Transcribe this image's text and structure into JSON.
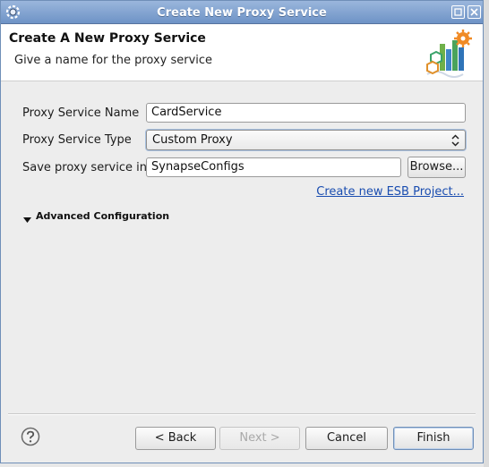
{
  "window": {
    "title": "Create New Proxy Service",
    "icons": {
      "app": "eclipse-gear-icon",
      "restore": "restore-icon",
      "close": "close-icon"
    }
  },
  "header": {
    "title": "Create A New Proxy Service",
    "subtitle": "Give a name for the proxy service",
    "banner_icon": "proxy-service-wizard-icon"
  },
  "form": {
    "name_label": "Proxy Service Name",
    "name_value": "CardService",
    "type_label": "Proxy Service Type",
    "type_value": "Custom Proxy",
    "save_label": "Save proxy service in:",
    "save_value": "SynapseConfigs",
    "browse_label": "Browse...",
    "create_project_link": "Create new ESB Project..."
  },
  "advanced": {
    "label": "Advanced Configuration",
    "expanded": true
  },
  "footer": {
    "help_icon": "help-icon",
    "back_label": "< Back",
    "next_label": "Next >",
    "cancel_label": "Cancel",
    "finish_label": "Finish"
  },
  "colors": {
    "titlebar": "#7f9fcf",
    "link": "#1a4db0",
    "dialog_bg": "#ededed"
  }
}
